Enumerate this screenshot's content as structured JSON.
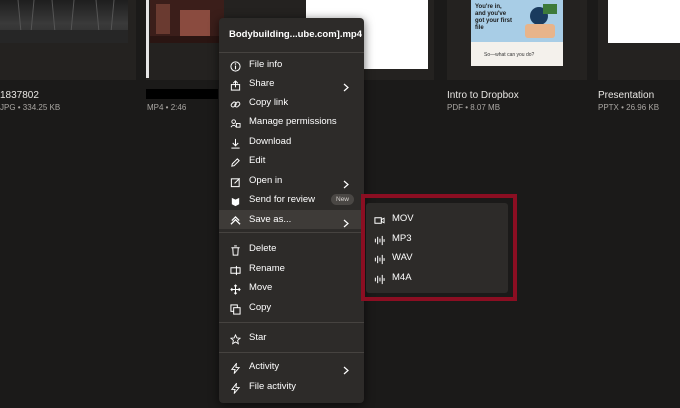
{
  "files": [
    {
      "name": "1837802",
      "meta": "JPG • 334.25 KB"
    },
    {
      "name": "",
      "meta": "MP4 • 2:46"
    },
    {
      "name": "Intro to Dropbox",
      "meta": "PDF • 8.07 MB",
      "thumb_text": "You're in, and you've got your first file",
      "thumb_subtext": "So—what can you do?"
    },
    {
      "name": "Presentation",
      "meta": "PPTX • 26.96 KB"
    }
  ],
  "context_menu": {
    "title": "Bodybuilding...ube.com].mp4",
    "items": [
      {
        "label": "File info",
        "icon": "info-icon"
      },
      {
        "label": "Share",
        "icon": "share-icon",
        "submenu": true
      },
      {
        "label": "Copy link",
        "icon": "link-icon"
      },
      {
        "label": "Manage permissions",
        "icon": "permissions-icon"
      },
      {
        "label": "Download",
        "icon": "download-icon"
      },
      {
        "label": "Edit",
        "icon": "edit-icon"
      },
      {
        "label": "Open in",
        "icon": "open-in-icon",
        "submenu": true
      },
      {
        "label": "Send for review",
        "icon": "review-icon",
        "badge": "New"
      },
      {
        "label": "Save as...",
        "icon": "save-as-icon",
        "submenu": true,
        "active": true
      },
      {
        "label": "Delete",
        "icon": "trash-icon"
      },
      {
        "label": "Rename",
        "icon": "rename-icon"
      },
      {
        "label": "Move",
        "icon": "move-icon"
      },
      {
        "label": "Copy",
        "icon": "copy-icon"
      },
      {
        "label": "Star",
        "icon": "star-icon"
      },
      {
        "label": "Activity",
        "icon": "activity-icon",
        "submenu": true
      },
      {
        "label": "File activity",
        "icon": "file-activity-icon"
      }
    ]
  },
  "save_as_submenu": {
    "items": [
      {
        "label": "MOV",
        "icon": "video-icon"
      },
      {
        "label": "MP3",
        "icon": "audio-icon"
      },
      {
        "label": "WAV",
        "icon": "audio-icon"
      },
      {
        "label": "M4A",
        "icon": "audio-icon"
      }
    ]
  },
  "colors": {
    "background": "#1b1a19",
    "menu": "#2d2b29",
    "menu_active": "#3e3b38",
    "highlight_border": "#8b0e22",
    "pdf_thumb": "#a8cde6"
  }
}
